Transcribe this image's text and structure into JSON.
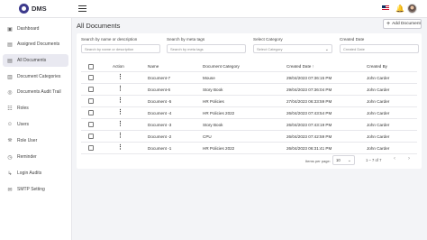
{
  "app": {
    "name": "DMS"
  },
  "sidebar": {
    "items": [
      {
        "label": "Dashboard",
        "icon": "dashboard-icon",
        "glyph": "▣"
      },
      {
        "label": "Assigned Documents",
        "icon": "assigned-documents-icon",
        "glyph": "▤"
      },
      {
        "label": "All Documents",
        "icon": "all-documents-icon",
        "glyph": "▤"
      },
      {
        "label": "Document Categories",
        "icon": "categories-icon",
        "glyph": "▥"
      },
      {
        "label": "Documents Audit Trail",
        "icon": "audit-trail-icon",
        "glyph": "◎"
      },
      {
        "label": "Roles",
        "icon": "roles-icon",
        "glyph": "☷"
      },
      {
        "label": "Users",
        "icon": "users-icon",
        "glyph": "☺"
      },
      {
        "label": "Role User",
        "icon": "role-user-icon",
        "glyph": "⛯"
      },
      {
        "label": "Reminder",
        "icon": "reminder-icon",
        "glyph": "◷"
      },
      {
        "label": "Login Audits",
        "icon": "login-audits-icon",
        "glyph": "↳"
      },
      {
        "label": "SMTP Setting",
        "icon": "smtp-setting-icon",
        "glyph": "✉"
      }
    ]
  },
  "page": {
    "title": "All Documents",
    "add_button_label": "Add Document"
  },
  "filters": {
    "search_name_label": "Search by name or description",
    "search_name_placeholder": "Search by name or description",
    "search_tags_label": "Search by meta tags",
    "search_tags_placeholder": "Search by meta tags",
    "category_label": "Select Category",
    "category_placeholder": "Select Category",
    "created_date_label": "Created Date",
    "created_date_value": "Created Date"
  },
  "table": {
    "columns": {
      "action": "Action",
      "name": "Name",
      "category": "Document Category",
      "created_date": "Created Date",
      "created_by": "Created By"
    },
    "rows": [
      {
        "name": "Document-7",
        "category": "Mouse",
        "created_date": "29/04/2023 07:36:15 PM",
        "created_by": "John Carder"
      },
      {
        "name": "Document-6",
        "category": "Story Book",
        "created_date": "29/04/2023 07:36:04 PM",
        "created_by": "John Carder"
      },
      {
        "name": "Document -5",
        "category": "HR Policies",
        "created_date": "27/04/2023 06:33:59 PM",
        "created_by": "John Carder"
      },
      {
        "name": "Document -4",
        "category": "HR Policies 2022",
        "created_date": "26/04/2023 07:43:54 PM",
        "created_by": "John Carder"
      },
      {
        "name": "Document -3",
        "category": "Story Book",
        "created_date": "26/04/2023 07:43:19 PM",
        "created_by": "John Carder"
      },
      {
        "name": "Document -2",
        "category": "CPU",
        "created_date": "26/04/2023 07:42:59 PM",
        "created_by": "John Carder"
      },
      {
        "name": "Document -1",
        "category": "HR Policies 2022",
        "created_date": "26/04/2023 06:31:41 PM",
        "created_by": "John Carder"
      }
    ]
  },
  "pagination": {
    "items_per_page_label": "Items per page:",
    "items_per_page": "10",
    "range": "1 – 7 of 7"
  }
}
